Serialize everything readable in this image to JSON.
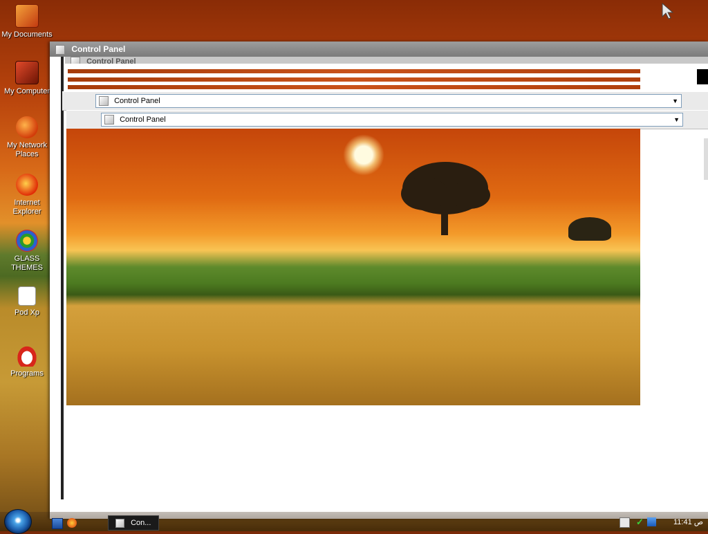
{
  "desktop": {
    "icons": [
      {
        "label": "My Documents",
        "icon": "my-documents-icon"
      },
      {
        "label": "My Computer",
        "icon": "my-computer-icon"
      },
      {
        "label": "My Network Places",
        "icon": "network-places-icon"
      },
      {
        "label": "Internet Explorer",
        "icon": "internet-explorer-icon"
      },
      {
        "label": "GLASS THEMES",
        "icon": "glass-themes-icon"
      },
      {
        "label": "Pod Xp",
        "icon": "pod-xp-icon"
      },
      {
        "label": "Programs",
        "icon": "programs-icon"
      }
    ]
  },
  "window": {
    "title": "Control Panel",
    "ghost_title": "Control Panel",
    "address_bar_1": "Control Panel",
    "address_bar_2": "Control Panel"
  },
  "taskbar": {
    "task_button": "Con...",
    "clock": "11:41 ص"
  }
}
